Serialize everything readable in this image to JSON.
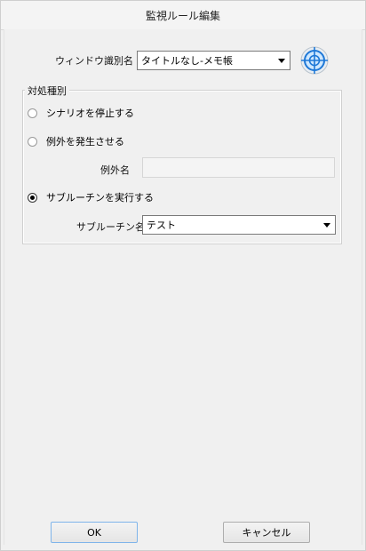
{
  "window": {
    "title": "監視ルール編集"
  },
  "window_name": {
    "label": "ウィンドウ識別名",
    "value": "タイトルなし-メモ帳",
    "finder_icon": "crosshair-target-icon"
  },
  "action_group": {
    "title": "対処種別",
    "options": [
      {
        "label": "シナリオを停止する",
        "selected": false
      },
      {
        "label": "例外を発生させる",
        "selected": false
      },
      {
        "label": "サブルーチンを実行する",
        "selected": true
      }
    ],
    "exception_name": {
      "label": "例外名",
      "value": ""
    },
    "subroutine_name": {
      "label": "サブルーチン名",
      "value": "テスト"
    }
  },
  "buttons": {
    "ok": "OK",
    "cancel": "キャンセル"
  },
  "colors": {
    "background": "#f0f0f0",
    "crosshair_blue": "#1e90ff",
    "ok_border": "#7eb4ea"
  }
}
